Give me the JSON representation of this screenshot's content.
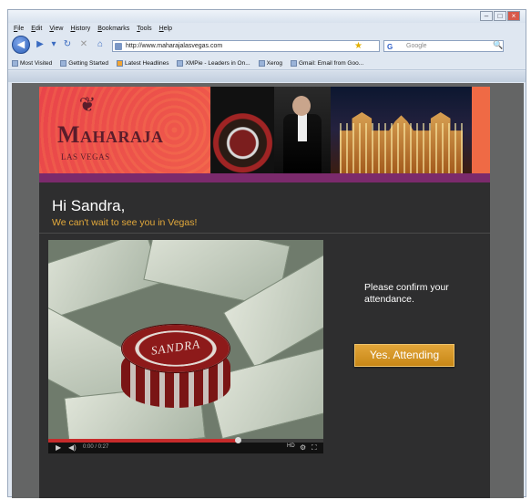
{
  "browser": {
    "menu": [
      "File",
      "Edit",
      "View",
      "History",
      "Bookmarks",
      "Tools",
      "Help"
    ],
    "url": "http://www.maharajalasvegas.com",
    "search_placeholder": "Google",
    "bookmarks": [
      "Most Visited",
      "Getting Started",
      "Latest Headlines",
      "XMPie - Leaders in On...",
      "Xerog",
      "Gmail: Email from Goo..."
    ]
  },
  "banner": {
    "logo_title": "Maharaja",
    "logo_subtitle": "LAS VEGAS",
    "chip_label": "SANDRA"
  },
  "content": {
    "greeting": "Hi Sandra,",
    "tagline": "We can't wait to see you in Vegas!",
    "confirm_text": "Please confirm your attendance.",
    "attend_label": "Yes. Attending"
  },
  "video": {
    "progress": 0.69,
    "time": "0:00 / 0:27"
  },
  "colors": {
    "accent": "#e3a93b",
    "button": "#d39a26",
    "banner": "#ef5a4b",
    "purple": "#7b2a6c"
  }
}
